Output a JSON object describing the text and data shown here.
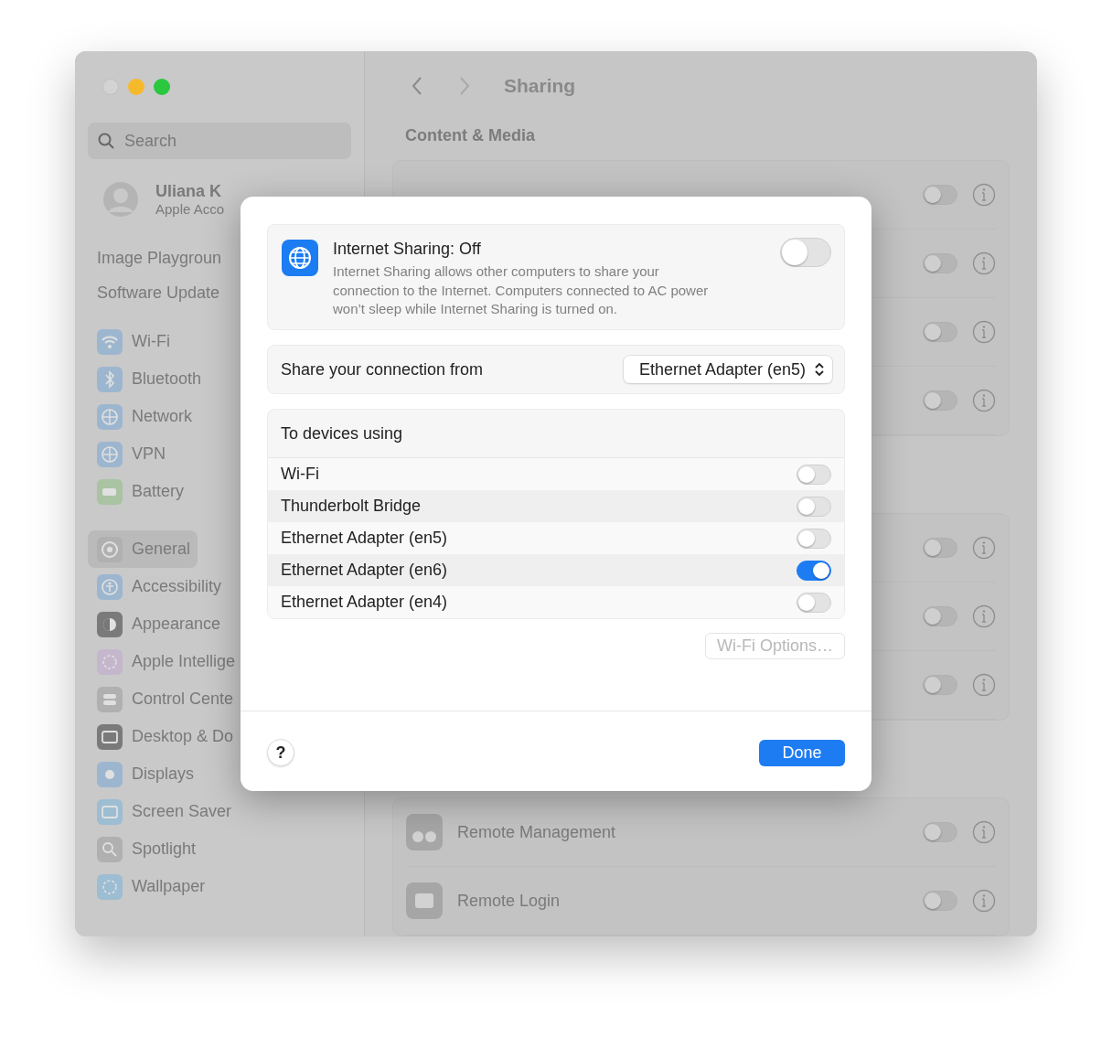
{
  "window": {
    "title": "Sharing"
  },
  "sidebar": {
    "search": {
      "placeholder": "Search"
    },
    "account": {
      "name": "Uliana K",
      "subtitle": "Apple Acco"
    },
    "top_items": [
      "Image Playgroun",
      "Software Update"
    ],
    "groups": [
      [
        {
          "label": "Wi-Fi",
          "selected": false,
          "color": "#9db6cf"
        },
        {
          "label": "Bluetooth",
          "selected": false,
          "color": "#9db6cf"
        },
        {
          "label": "Network",
          "selected": false,
          "color": "#9db6cf"
        },
        {
          "label": "VPN",
          "selected": false,
          "color": "#9db6cf"
        },
        {
          "label": "Battery",
          "selected": false,
          "color": "#a9c3a3"
        }
      ],
      [
        {
          "label": "General",
          "selected": true,
          "color": "#b0b0b1"
        },
        {
          "label": "Accessibility",
          "selected": false,
          "color": "#9db6cf"
        },
        {
          "label": "Appearance",
          "selected": false,
          "color": "#7a7a7b"
        },
        {
          "label": "Apple Intellige",
          "selected": false,
          "color": "#c4b7cc"
        },
        {
          "label": "Control Cente",
          "selected": false,
          "color": "#b0b0b1"
        },
        {
          "label": "Desktop & Do",
          "selected": false,
          "color": "#7a7a7b"
        },
        {
          "label": "Displays",
          "selected": false,
          "color": "#9db6cf"
        },
        {
          "label": "Screen Saver",
          "selected": false,
          "color": "#9dbdd2"
        },
        {
          "label": "Spotlight",
          "selected": false,
          "color": "#b0b0b1"
        },
        {
          "label": "Wallpaper",
          "selected": false,
          "color": "#9dbdd2"
        }
      ]
    ]
  },
  "main": {
    "section": "Content & Media",
    "groups": [
      [
        {
          "on": false
        },
        {
          "on": false
        },
        {
          "on": false
        },
        {
          "on": false
        }
      ],
      [
        {
          "on": false
        },
        {
          "on": false
        },
        {
          "on": false
        }
      ],
      [
        {
          "label": "Remote Management",
          "on": false
        },
        {
          "label": "Remote Login",
          "on": false
        }
      ]
    ]
  },
  "dialog": {
    "title": "Internet Sharing: Off",
    "on": false,
    "description": "Internet Sharing allows other computers to share your connection to the Internet. Computers connected to AC power won’t sleep while Internet Sharing is turned on.",
    "source_label": "Share your connection from",
    "source_value": "Ethernet Adapter (en5)",
    "devices_heading": "To devices using",
    "devices": [
      {
        "label": "Wi-Fi",
        "on": false
      },
      {
        "label": "Thunderbolt Bridge",
        "on": false
      },
      {
        "label": "Ethernet Adapter (en5)",
        "on": false
      },
      {
        "label": "Ethernet Adapter (en6)",
        "on": true
      },
      {
        "label": "Ethernet Adapter (en4)",
        "on": false
      }
    ],
    "options_button": {
      "label": "Wi-Fi Options…",
      "disabled": true
    },
    "help": "?",
    "done": "Done"
  }
}
